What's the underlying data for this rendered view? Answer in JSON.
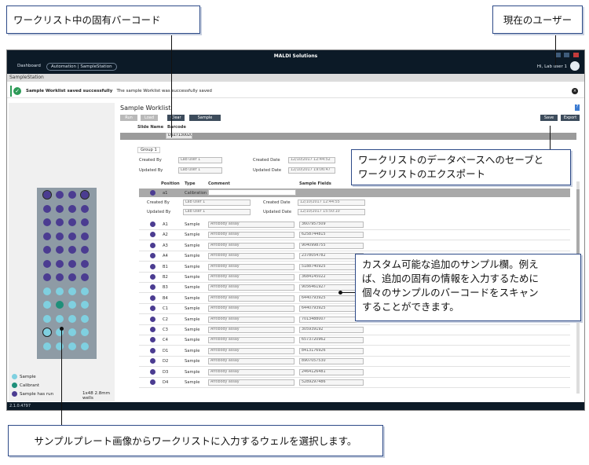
{
  "callouts": {
    "barcode": "ワークリスト中の固有バーコード",
    "user": "現在のユーザー",
    "save_export": [
      "ワークリストのデータベースへのセーブと",
      "ワークリストのエクスポート"
    ],
    "custom": [
      "カスタム可能な追加のサンプル欄。例え",
      "ば、追加の固有の情報を入力するために",
      "個々のサンプルのバーコードをスキャン",
      "することができます。"
    ],
    "wells": "サンプルプレート画像からワークリストに入力するウェルを選択します。"
  },
  "app": {
    "title": "MALDI Solutions",
    "tabs": [
      "Dashboard",
      "Automation | SampleStation"
    ],
    "user": "Hi, Lab user 1",
    "breadcrumb": "SampleStation",
    "notice_bold": "Sample Worklist saved successfully",
    "notice_text": "The sample Worklist was successfully saved",
    "version": "2.1.0.4797"
  },
  "left_panel": {
    "legend": [
      {
        "label": "Sample",
        "color": "#7fd0e0"
      },
      {
        "label": "Calibrant",
        "color": "#1f8f7a"
      },
      {
        "label": "Sample has run",
        "color": "#4b3c91"
      }
    ],
    "plate_label": "1x48 2.8mm wells"
  },
  "worklist": {
    "title": "Sample Worklist",
    "buttons": [
      "Run",
      "Load",
      "Clear",
      "Sample Group"
    ],
    "save_button": "Save",
    "export_button": "Export",
    "header": {
      "slide_name": "Slide Name",
      "barcode": "Barcode"
    },
    "barcode_value": "DS171300206",
    "group_tab": "Group 1",
    "group": {
      "created_by_label": "Created By",
      "created_by": "Lab user 1",
      "updated_by_label": "Updated By",
      "updated_by": "Lab user 1",
      "created_date_label": "Created Date",
      "created_date": "12/10/2017 12:44:52",
      "updated_date_label": "Updated Date",
      "updated_date": "12/10/2017 19:06:47"
    },
    "columns": [
      "Position",
      "Type",
      "Comment",
      "Sample Fields"
    ],
    "calibration_row": {
      "position": "a1",
      "type": "Calibration"
    },
    "sub": {
      "created_by": "Lab user 1",
      "updated_by": "Lab user 1",
      "created_date": "12/10/2017 12:44:55",
      "updated_date": "12/10/2017 15:50:10"
    },
    "rows": [
      {
        "position": "A1",
        "type": "Sample",
        "comment": "Antibody assay",
        "field": "3607957509"
      },
      {
        "position": "A2",
        "type": "Sample",
        "comment": "Antibody assay",
        "field": "6258744815"
      },
      {
        "position": "A3",
        "type": "Sample",
        "comment": "Antibody assay",
        "field": "9040998755"
      },
      {
        "position": "A4",
        "type": "Sample",
        "comment": "Antibody assay",
        "field": "2378054782"
      },
      {
        "position": "B1",
        "type": "Sample",
        "comment": "Antibody assay",
        "field": "5188740925"
      },
      {
        "position": "B2",
        "type": "Sample",
        "comment": "Antibody assay",
        "field": "3684145022"
      },
      {
        "position": "B3",
        "type": "Sample",
        "comment": "Antibody assay",
        "field": "9056461927"
      },
      {
        "position": "B4",
        "type": "Sample",
        "comment": "Antibody assay",
        "field": "6440793925"
      },
      {
        "position": "C1",
        "type": "Sample",
        "comment": "Antibody assay",
        "field": "6440793925"
      },
      {
        "position": "C2",
        "type": "Sample",
        "comment": "Antibody assay",
        "field": "7013488007"
      },
      {
        "position": "C3",
        "type": "Sample",
        "comment": "Antibody assay",
        "field": "305939192"
      },
      {
        "position": "C4",
        "type": "Sample",
        "comment": "Antibody assay",
        "field": "6573720962"
      },
      {
        "position": "D1",
        "type": "Sample",
        "comment": "Antibody assay",
        "field": "8413176926"
      },
      {
        "position": "D2",
        "type": "Sample",
        "comment": "Antibody assay",
        "field": "8907057530"
      },
      {
        "position": "D3",
        "type": "Sample",
        "comment": "Antibody assay",
        "field": "2464126481"
      },
      {
        "position": "D4",
        "type": "Sample",
        "comment": "Antibody assay",
        "field": "5289297486"
      }
    ]
  }
}
